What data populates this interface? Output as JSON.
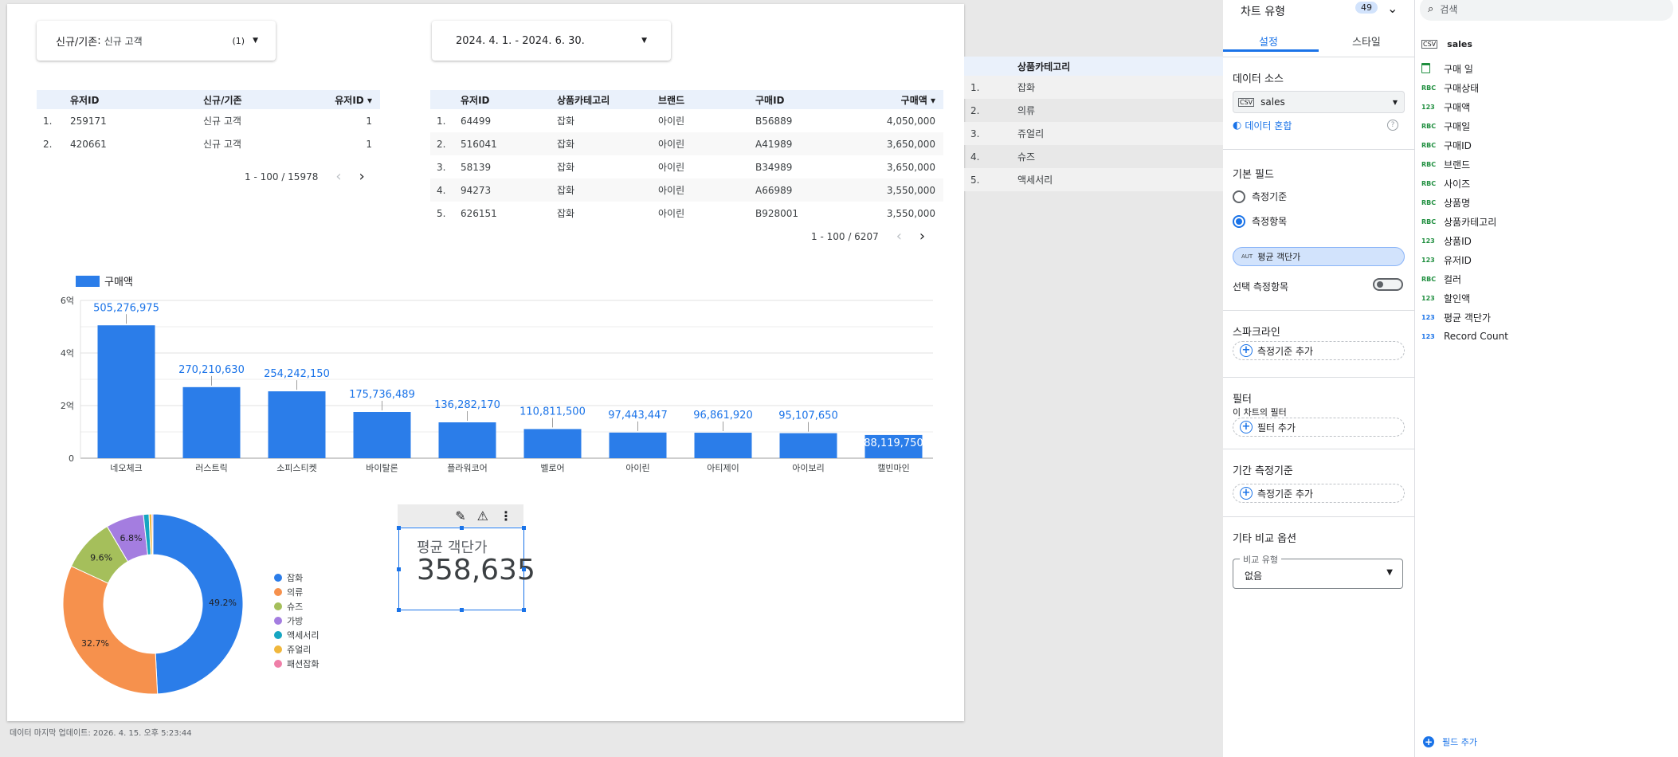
{
  "filter_control": {
    "label": "신규/기존",
    "value": "신규 고객",
    "count": "(1)"
  },
  "date_control": {
    "value": "2024. 4. 1. - 2024. 6. 30."
  },
  "table1": {
    "headers": [
      "유저ID",
      "신규/기존",
      "유저ID"
    ],
    "sort_icon": "▾",
    "rows": [
      [
        "1.",
        "259171",
        "신규 고객",
        "1"
      ],
      [
        "2.",
        "420661",
        "신규 고객",
        "1"
      ]
    ],
    "pager": "1 - 100 / 15978"
  },
  "table2": {
    "headers": [
      "유저ID",
      "상품카테고리",
      "브랜드",
      "구매ID",
      "구매액"
    ],
    "sort_icon": "▾",
    "rows": [
      [
        "1.",
        "64499",
        "잡화",
        "아이린",
        "B56889",
        "4,050,000"
      ],
      [
        "2.",
        "516041",
        "잡화",
        "아이린",
        "A41989",
        "3,650,000"
      ],
      [
        "3.",
        "58139",
        "잡화",
        "아이린",
        "B34989",
        "3,650,000"
      ],
      [
        "4.",
        "94273",
        "잡화",
        "아이린",
        "A66989",
        "3,550,000"
      ],
      [
        "5.",
        "626151",
        "잡화",
        "아이린",
        "B928001",
        "3,550,000"
      ]
    ],
    "pager": "1 - 100 / 6207"
  },
  "chart_data": [
    {
      "type": "bar",
      "legend": "구매액",
      "categories": [
        "네오체크",
        "러스트릭",
        "소피스티켓",
        "바이탈론",
        "플라워코어",
        "벨로어",
        "아이린",
        "아티제이",
        "아이보리",
        "캘빈마인"
      ],
      "values": [
        505276975,
        270210630,
        254242150,
        175736489,
        136282170,
        110811500,
        97443447,
        96861920,
        95107650,
        88119750
      ],
      "value_labels": [
        "505,276,975",
        "270,210,630",
        "254,242,150",
        "175,736,489",
        "136,282,170",
        "110,811,500",
        "97,443,447",
        "96,861,920",
        "95,107,650",
        "88,119,750"
      ],
      "y_ticks": [
        {
          "v": 0,
          "label": "0"
        },
        {
          "v": 200000000,
          "label": "2억"
        },
        {
          "v": 400000000,
          "label": "4억"
        },
        {
          "v": 600000000,
          "label": "6억"
        }
      ],
      "ylim": [
        0,
        600000000
      ],
      "color": "#2b7de9"
    },
    {
      "type": "pie",
      "donut": true,
      "labels": [
        "잡화",
        "의류",
        "슈즈",
        "가방",
        "액세서리",
        "쥬얼리",
        "패션잡화"
      ],
      "values": [
        49.2,
        32.7,
        9.6,
        6.8,
        1.0,
        0.5,
        0.2
      ],
      "value_labels": [
        "49.2%",
        "32.7%",
        "9.6%",
        "6.8%",
        "",
        "",
        ""
      ],
      "colors": [
        "#2b7de9",
        "#f6914d",
        "#a5bf5b",
        "#a47de0",
        "#16a6c2",
        "#f0b73c",
        "#ef7fa8"
      ]
    }
  ],
  "scorecard": {
    "label": "평균 객단가",
    "value": "358,635"
  },
  "footer": "데이터 마지막 업데이트: 2026. 4. 15. 오후 5:23:44",
  "ext_table": {
    "header": "상품카테고리",
    "rows": [
      [
        "1.",
        "잡화"
      ],
      [
        "2.",
        "의류"
      ],
      [
        "3.",
        "쥬얼리"
      ],
      [
        "4.",
        "슈즈"
      ],
      [
        "5.",
        "액세서리"
      ]
    ]
  },
  "panel": {
    "chart_type_label": "차트 유형",
    "badge": "49",
    "tabs": [
      "설정",
      "스타일"
    ],
    "data_source_title": "데이터 소스",
    "data_source": "sales",
    "data_source_icon_text": "CSV",
    "blend_label": "데이터 혼합",
    "basic_field_title": "기본 필드",
    "radio_dimension": "측정기준",
    "radio_metric": "측정항목",
    "metric_chip_type": "AUT",
    "metric_chip": "평균 객단가",
    "optional_metric": "선택 측정항목",
    "sparkline_title": "스파크라인",
    "add_dimension": "측정기준 추가",
    "filter_title": "필터",
    "filter_sub": "이 차트의 필터",
    "add_filter": "필터 추가",
    "period_title": "기간 측정기준",
    "add_dimension2": "측정기준 추가",
    "compare_title": "기타 비교 옵션",
    "compare_legend": "비교 유형",
    "compare_value": "없음"
  },
  "fields": {
    "search_placeholder": "검색",
    "source_icon_text": "CSV",
    "source": "sales",
    "items": [
      {
        "type": "date",
        "type_label": "",
        "name": "구매 일"
      },
      {
        "type": "text",
        "type_label": "RBC",
        "name": "구매상태"
      },
      {
        "type": "num",
        "type_label": "123",
        "name": "구매액"
      },
      {
        "type": "text",
        "type_label": "RBC",
        "name": "구매일"
      },
      {
        "type": "text",
        "type_label": "RBC",
        "name": "구매ID"
      },
      {
        "type": "text",
        "type_label": "RBC",
        "name": "브랜드"
      },
      {
        "type": "text",
        "type_label": "RBC",
        "name": "사이즈"
      },
      {
        "type": "text",
        "type_label": "RBC",
        "name": "상품명"
      },
      {
        "type": "text",
        "type_label": "RBC",
        "name": "상품카테고리"
      },
      {
        "type": "num",
        "type_label": "123",
        "name": "상품ID"
      },
      {
        "type": "num",
        "type_label": "123",
        "name": "유저ID"
      },
      {
        "type": "text",
        "type_label": "RBC",
        "name": "컬러"
      },
      {
        "type": "num",
        "type_label": "123",
        "name": "할인액"
      },
      {
        "type": "calc",
        "type_label": "123",
        "name": "평균 객단가"
      },
      {
        "type": "calc",
        "type_label": "123",
        "name": "Record Count"
      }
    ],
    "add_field": "필드 추가"
  }
}
